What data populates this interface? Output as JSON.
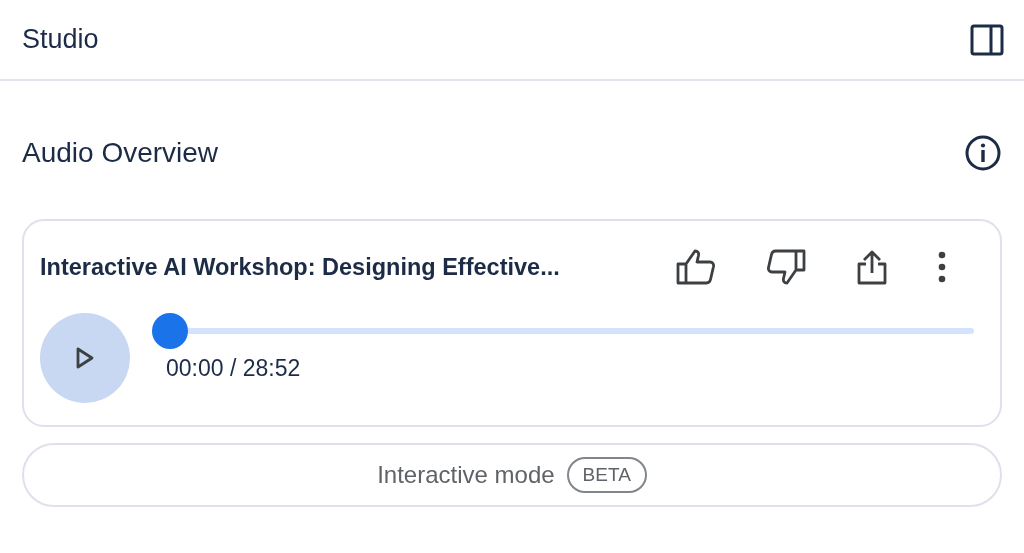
{
  "header": {
    "title": "Studio"
  },
  "section": {
    "title": "Audio Overview"
  },
  "audio_card": {
    "title": "Interactive AI Workshop: Designing Effective...",
    "playing": false,
    "progress": {
      "level": 0
    },
    "time": "00:00 / 28:52"
  },
  "mode_button": {
    "label": "Interactive mode",
    "badge": "BETA"
  }
}
